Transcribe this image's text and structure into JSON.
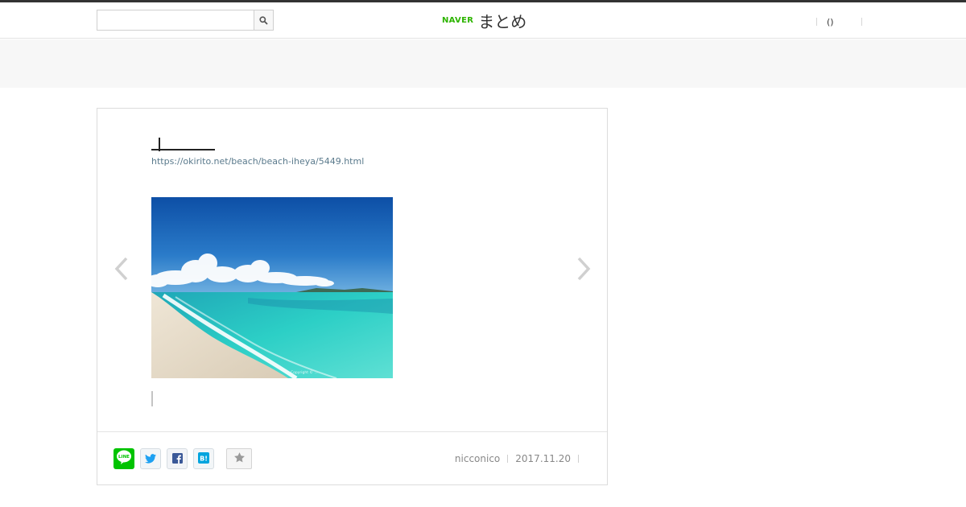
{
  "header": {
    "search": {
      "placeholder": "",
      "value": ""
    },
    "logo": {
      "brand": "NAVER",
      "name": "まとめ"
    },
    "right": {
      "paren": "()"
    }
  },
  "item": {
    "source_url": "https://okirito.net/beach/beach-iheya/5449.html",
    "image": {
      "alt": "",
      "caption": "Copyright © ..."
    }
  },
  "footer": {
    "share": [
      {
        "name": "line-icon",
        "label": "LINE"
      },
      {
        "name": "twitter-icon",
        "label": ""
      },
      {
        "name": "facebook-icon",
        "label": ""
      },
      {
        "name": "hatena-bookmark-icon",
        "label": "B!"
      },
      {
        "name": "star-icon",
        "label": ""
      }
    ],
    "author": "nicconico",
    "date": "2017.11.20"
  },
  "colors": {
    "naver_green": "#2db400",
    "line_green": "#00c300",
    "link": "#5a7a8c",
    "twitter": "#1da1f2",
    "facebook": "#3b5998",
    "hatena": "#00a4de"
  }
}
